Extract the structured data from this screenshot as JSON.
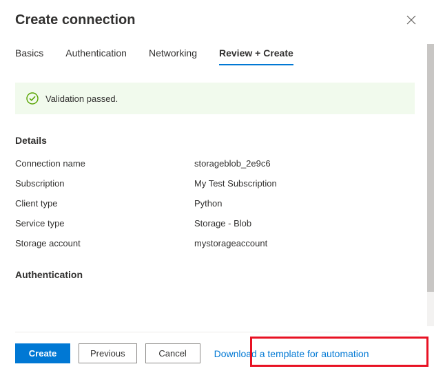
{
  "header": {
    "title": "Create connection"
  },
  "tabs": {
    "basics": "Basics",
    "authentication": "Authentication",
    "networking": "Networking",
    "review": "Review + Create"
  },
  "validation": {
    "message": "Validation passed."
  },
  "sections": {
    "details_title": "Details",
    "authentication_title": "Authentication"
  },
  "details": {
    "connection_name": {
      "label": "Connection name",
      "value": "storageblob_2e9c6"
    },
    "subscription": {
      "label": "Subscription",
      "value": "My Test Subscription"
    },
    "client_type": {
      "label": "Client type",
      "value": "Python"
    },
    "service_type": {
      "label": "Service type",
      "value": "Storage - Blob"
    },
    "storage_account": {
      "label": "Storage account",
      "value": "mystorageaccount"
    }
  },
  "footer": {
    "create": "Create",
    "previous": "Previous",
    "cancel": "Cancel",
    "download_template": "Download a template for automation"
  }
}
